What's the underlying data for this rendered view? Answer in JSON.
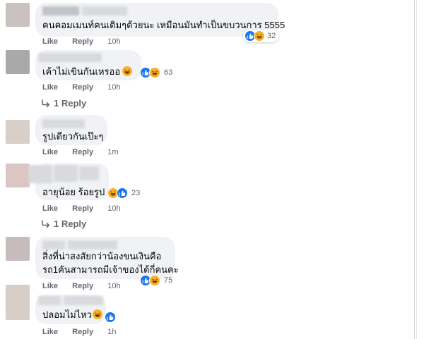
{
  "comments": [
    {
      "text": "คนคอมเมนท์คนเดิมๆด้วยนะ เหมือนมันทำเป็นขบวนการ 5555",
      "reactions": {
        "icons": [
          "like-icon",
          "haha-icon"
        ],
        "count": "32"
      },
      "actions": {
        "like": "Like",
        "reply": "Reply",
        "time": "10h"
      }
    },
    {
      "text": "เค้าไม่เขินกันเหรออ",
      "reactions": {
        "icons": [
          "like-icon",
          "haha-icon"
        ],
        "count": "63"
      },
      "actions": {
        "like": "Like",
        "reply": "Reply",
        "time": "10h"
      },
      "replies_link": "1 Reply"
    },
    {
      "text": "รูปเดียวกันเป๊ะๆ",
      "actions": {
        "like": "Like",
        "reply": "Reply",
        "time": "1m"
      }
    },
    {
      "text": "อายุน้อย ร้อยรูป",
      "reactions": {
        "icons": [
          "haha-icon",
          "like-icon"
        ],
        "count": "23"
      },
      "actions": {
        "like": "Like",
        "reply": "Reply",
        "time": "10h"
      },
      "replies_link": "1 Reply"
    },
    {
      "text_lines": [
        "สิ่งที่น่าสงสัยกว่าน้องขนเงินคือ",
        "รถ1คันสามารถมีเจ้าของได้กี่คนคะ"
      ],
      "reactions": {
        "icons": [
          "like-icon",
          "haha-icon"
        ],
        "count": "75"
      },
      "actions": {
        "like": "Like",
        "reply": "Reply",
        "time": "10h"
      }
    },
    {
      "text": "ปลอมไม่ไหว",
      "reactions": {
        "icons": [
          "like-icon"
        ],
        "count": ""
      },
      "actions": {
        "like": "Like",
        "reply": "Reply",
        "time": "1h"
      }
    }
  ],
  "colors": {
    "like_blue": "#1877f2",
    "haha_yellow": "#f7b125",
    "bubble_bg": "#f0f2f5",
    "meta_gray": "#65676b"
  }
}
